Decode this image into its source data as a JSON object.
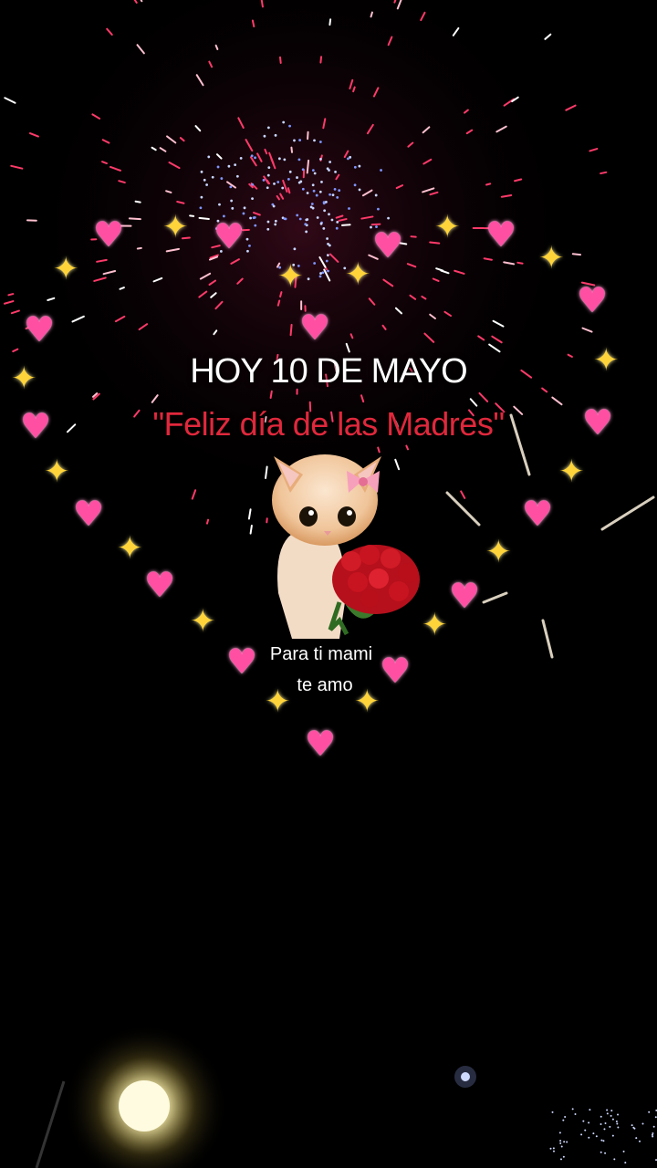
{
  "title": "HOY 10 DE MAYO",
  "subtitle": "\"Feliz día de las Madres\"",
  "caption_line1": "Para ti mami",
  "caption_line2": "te amo",
  "icons": {
    "heart": "heart-emoji",
    "sparkle": "sparkles-emoji",
    "cat": "kitten-with-roses",
    "fireworks": "fireworks-background",
    "street_lamp": "street-lamp-light"
  },
  "colors": {
    "background": "#000000",
    "title": "#ffffff",
    "subtitle": "#e0283c",
    "heart": "#ff4fa3",
    "sparkle": "#ffd43a"
  }
}
